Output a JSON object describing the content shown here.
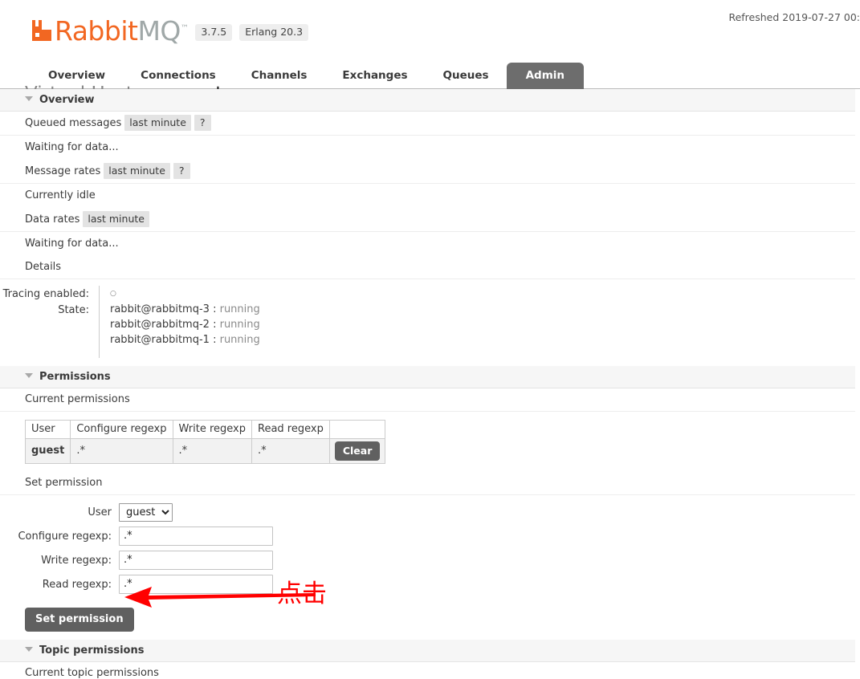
{
  "header": {
    "refreshed": "Refreshed 2019-07-27 00:",
    "logo_rabbit": "Rabbit",
    "logo_mq": "MQ",
    "logo_tm": "™",
    "version": "3.7.5",
    "erlang": "Erlang 20.3"
  },
  "nav": {
    "items": [
      {
        "label": "Overview",
        "active": false
      },
      {
        "label": "Connections",
        "active": false
      },
      {
        "label": "Channels",
        "active": false
      },
      {
        "label": "Exchanges",
        "active": false
      },
      {
        "label": "Queues",
        "active": false
      },
      {
        "label": "Admin",
        "active": true
      }
    ]
  },
  "page": {
    "title_prefix": "Virtual Host:",
    "title_name": "coresystem"
  },
  "overview": {
    "section_label": "Overview",
    "queued_messages_label": "Queued messages",
    "queued_messages_period": "last minute",
    "queued_messages_help": "?",
    "queued_messages_status": "Waiting for data...",
    "message_rates_label": "Message rates",
    "message_rates_period": "last minute",
    "message_rates_help": "?",
    "message_rates_status": "Currently idle",
    "data_rates_label": "Data rates",
    "data_rates_period": "last minute",
    "data_rates_status": "Waiting for data...",
    "details_label": "Details",
    "tracing_key": "Tracing enabled:",
    "tracing_value": "○",
    "state_key": "State:",
    "state_nodes": [
      {
        "node": "rabbit@rabbitmq-3",
        "sep": " : ",
        "status": "running"
      },
      {
        "node": "rabbit@rabbitmq-2",
        "sep": " : ",
        "status": "running"
      },
      {
        "node": "rabbit@rabbitmq-1",
        "sep": " : ",
        "status": "running"
      }
    ]
  },
  "permissions": {
    "section_label": "Permissions",
    "current_label": "Current permissions",
    "columns": [
      "User",
      "Configure regexp",
      "Write regexp",
      "Read regexp",
      ""
    ],
    "rows": [
      {
        "user": "guest",
        "configure": ".*",
        "write": ".*",
        "read": ".*",
        "action": "Clear"
      }
    ],
    "set_label": "Set permission",
    "form": {
      "user_label": "User",
      "user_value": "guest",
      "user_options": [
        "guest"
      ],
      "configure_label": "Configure regexp:",
      "configure_value": ".*",
      "write_label": "Write regexp:",
      "write_value": ".*",
      "read_label": "Read regexp:",
      "read_value": ".*",
      "submit_label": "Set permission"
    }
  },
  "topic_permissions": {
    "section_label": "Topic permissions",
    "current_label": "Current topic permissions"
  },
  "annotation": {
    "text": "点击",
    "color": "#ff0000"
  }
}
